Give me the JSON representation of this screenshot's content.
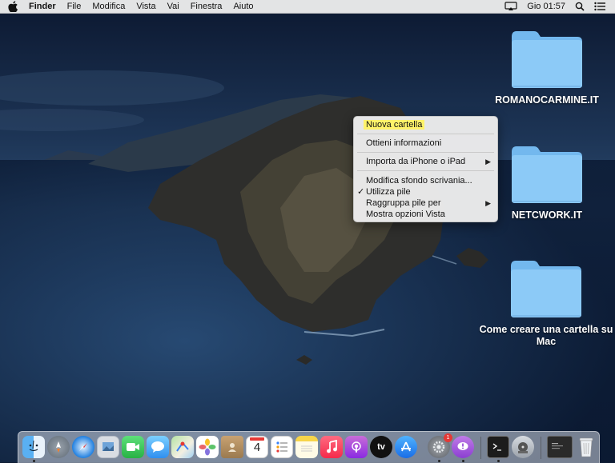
{
  "menubar": {
    "app_name": "Finder",
    "menus": [
      "File",
      "Modifica",
      "Vista",
      "Vai",
      "Finestra",
      "Aiuto"
    ],
    "clock": "Gio 01:57"
  },
  "desktop_items": [
    {
      "label": "ROMANOCARMINE.IT"
    },
    {
      "label": "NETCWORK.IT"
    },
    {
      "label": "Come creare una cartella su Mac"
    }
  ],
  "context_menu": {
    "items": [
      {
        "label": "Nuova cartella",
        "highlighted": true
      },
      {
        "label": "Ottieni informazioni"
      },
      {
        "label": "Importa da iPhone o iPad",
        "submenu": true
      },
      {
        "label": "Modifica sfondo scrivania..."
      },
      {
        "label": "Utilizza pile",
        "checked": true
      },
      {
        "label": "Raggruppa pile per",
        "submenu": true
      },
      {
        "label": "Mostra opzioni Vista"
      }
    ],
    "check_glyph": "✓",
    "submenu_glyph": "▶"
  },
  "dock": {
    "apps": [
      {
        "name": "finder-icon",
        "running": true
      },
      {
        "name": "launchpad-icon"
      },
      {
        "name": "safari-icon"
      },
      {
        "name": "preview-icon"
      },
      {
        "name": "facetime-icon"
      },
      {
        "name": "messages-icon"
      },
      {
        "name": "maps-icon"
      },
      {
        "name": "photos-icon"
      },
      {
        "name": "contacts-icon"
      },
      {
        "name": "calendar-icon",
        "text": "4"
      },
      {
        "name": "reminders-icon"
      },
      {
        "name": "notes-icon"
      },
      {
        "name": "music-icon"
      },
      {
        "name": "podcasts-icon"
      },
      {
        "name": "apple-tv-icon",
        "text": "tv"
      },
      {
        "name": "app-store-icon"
      },
      {
        "name": "system-preferences-icon",
        "badge": "1",
        "running": true
      },
      {
        "name": "feedback-assistant-icon",
        "running": true
      },
      {
        "name": "terminal-icon",
        "running": true
      },
      {
        "name": "disk-utility-icon"
      },
      {
        "name": "recent-window-icon"
      },
      {
        "name": "trash-icon"
      }
    ]
  },
  "colors": {
    "highlight": "#fff36a",
    "folder": "#8ccaf7"
  }
}
